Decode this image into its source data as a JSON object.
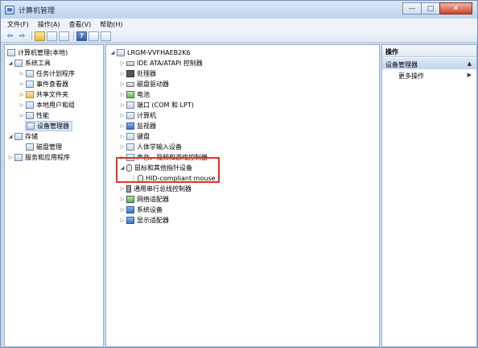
{
  "window": {
    "title": "计算机管理",
    "controls": [
      "—",
      "□",
      "✕"
    ]
  },
  "menu": [
    "文件(F)",
    "操作(A)",
    "查看(V)",
    "帮助(H)"
  ],
  "toolbar": {
    "back": "⇦",
    "forward": "⇨",
    "help": "?"
  },
  "left_tree": {
    "root": "计算机管理(本地)",
    "system_tools": "系统工具",
    "task_scheduler": "任务计划程序",
    "event_viewer": "事件查看器",
    "shared_folders": "共享文件夹",
    "local_users": "本地用户和组",
    "performance": "性能",
    "device_manager": "设备管理器",
    "storage": "存储",
    "disk_management": "磁盘管理",
    "services": "服务和应用程序"
  },
  "device_tree": {
    "computer_name": "LRGM-VVFHAEB2K6",
    "items": [
      "IDE ATA/ATAPI 控制器",
      "处理器",
      "磁盘驱动器",
      "电池",
      "端口 (COM 和 LPT)",
      "计算机",
      "监视器",
      "键盘",
      "人体学输入设备",
      "声音、视频和游戏控制器",
      "鼠标和其他指针设备",
      "HID-compliant mouse",
      "通用串行总线控制器",
      "网络适配器",
      "系统设备",
      "显示适配器"
    ]
  },
  "actions": {
    "header": "操作",
    "selected": "设备管理器",
    "more": "更多操作"
  },
  "colors": {
    "highlight": "#e0312c",
    "selection": "#dbe8f7"
  }
}
